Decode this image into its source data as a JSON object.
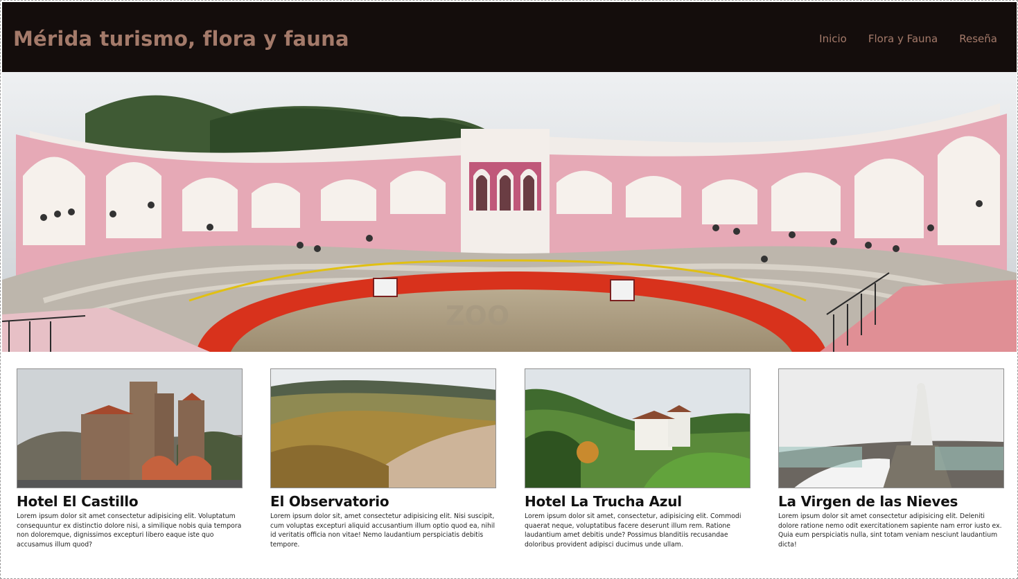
{
  "header": {
    "title": "Mérida turismo, flora y fauna",
    "nav": [
      {
        "label": "Inicio"
      },
      {
        "label": "Flora y Fauna"
      },
      {
        "label": "Reseña"
      }
    ]
  },
  "hero": {
    "image": "bullring-panorama-photo",
    "sign_text": "ZOO"
  },
  "cards": [
    {
      "title": "Hotel El Castillo",
      "image": "stone-castle-photo",
      "text": "Lorem ipsum dolor sit amet consectetur adipisicing elit. Voluptatum consequuntur ex distinctio dolore nisi, a similique nobis quia tempora non doloremque, dignissimos excepturi libero eaque iste quo accusamus illum quod?"
    },
    {
      "title": "El Observatorio",
      "image": "mountain-valley-photo",
      "text": "Lorem ipsum dolor sit, amet consectetur adipisicing elit. Nisi suscipit, cum voluptas excepturi aliquid accusantium illum optio quod ea, nihil id veritatis officia non vitae! Nemo laudantium perspiciatis debitis tempore."
    },
    {
      "title": "Hotel La Trucha Azul",
      "image": "white-hotel-garden-photo",
      "text": "Lorem ipsum dolor sit amet, consectetur, adipisicing elit. Commodi quaerat neque, voluptatibus facere deserunt illum rem. Ratione laudantium amet debitis unde? Possimus blanditiis recusandae doloribus provident adipisci ducimus unde ullam."
    },
    {
      "title": "La Virgen de las Nieves",
      "image": "virgin-statue-snow-photo",
      "text": "Lorem ipsum dolor sit amet consectetur adipisicing elit. Deleniti dolore ratione nemo odit exercitationem sapiente nam error iusto ex. Quia eum perspiciatis nulla, sint totam veniam nesciunt laudantium dicta!"
    }
  ],
  "colors": {
    "header_bg": "#140d0c",
    "brand_text": "#a47a6a",
    "page_bg": "#ffffff"
  }
}
